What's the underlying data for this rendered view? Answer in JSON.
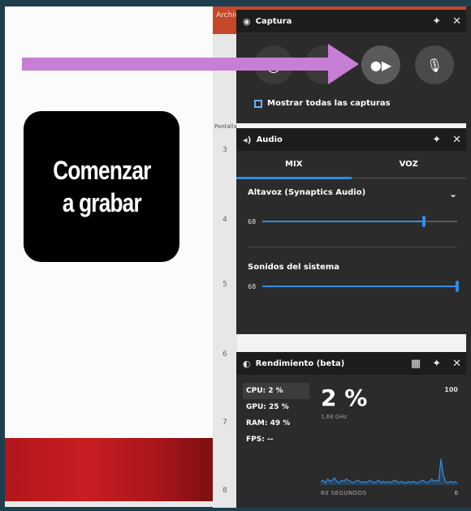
{
  "label": {
    "line1": "Comenzar",
    "line2": "a grabar"
  },
  "capture": {
    "title": "Captura",
    "buttons": [
      {
        "name": "screenshot",
        "icon": "camera-icon"
      },
      {
        "name": "record",
        "icon": "record-icon",
        "highlighted": true
      },
      {
        "name": "mic",
        "icon": "microphone-icon"
      }
    ],
    "show_all": "Mostrar todas las capturas"
  },
  "audio": {
    "title": "Audio",
    "tabs": [
      "MIX",
      "VOZ"
    ],
    "active_tab": "MIX",
    "device": "Altavoz (Synaptics Audio)",
    "device_volume_label": "68",
    "device_volume_fraction": 0.83,
    "system_label": "Sonidos del sistema",
    "system_volume_label": "68",
    "system_volume_fraction": 1.0
  },
  "performance": {
    "title": "Rendimiento (beta)",
    "stats": [
      {
        "label": "CPU: 2 %"
      },
      {
        "label": "GPU: 25 %"
      },
      {
        "label": "RAM: 49 %"
      },
      {
        "label": "FPS: --"
      }
    ],
    "big_value": "2 %",
    "sub_value": "1,68 GHz",
    "max_label": "100",
    "time_label": "60 SEGUNDOS",
    "min_label": "0",
    "cpu_history": [
      3,
      4,
      2,
      5,
      3,
      4,
      6,
      3,
      2,
      4,
      3,
      5,
      4,
      3,
      2,
      3,
      4,
      3,
      2,
      3,
      2,
      4,
      3,
      2,
      3,
      4,
      2,
      3,
      2,
      3,
      2,
      3,
      4,
      3,
      2,
      3,
      2,
      2,
      3,
      2,
      3,
      2,
      2,
      3,
      4,
      3,
      2,
      3,
      5,
      3,
      4,
      3,
      22,
      8,
      3,
      2,
      3,
      2,
      3,
      2
    ]
  },
  "editor": {
    "tab": "Archivo",
    "thumb_label": "Pantalla",
    "slide_numbers": [
      "3",
      "4",
      "5",
      "6",
      "7",
      "8"
    ]
  },
  "colors": {
    "accent": "#2f8de4",
    "arrow": "#c77fd5",
    "panel": "#2b2b2b",
    "header": "#1d1d1d"
  }
}
